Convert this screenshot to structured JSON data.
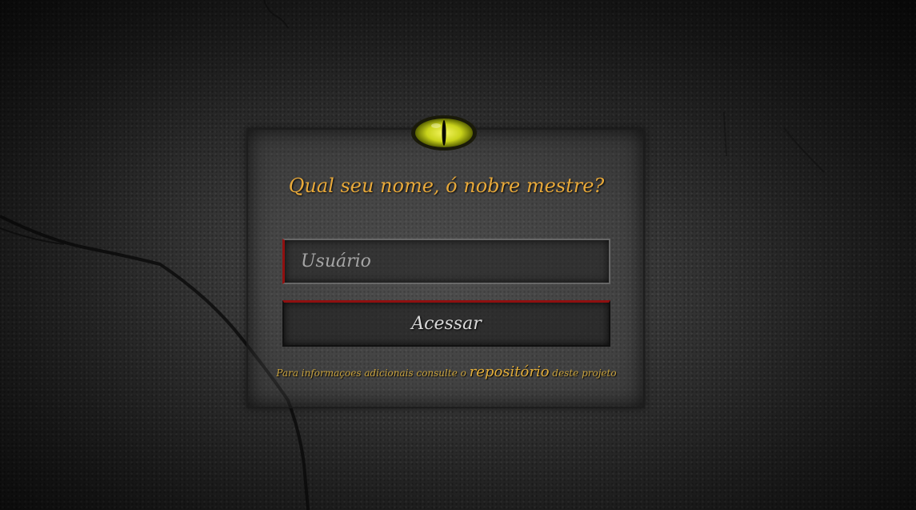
{
  "login": {
    "title": "Qual seu nome, ó nobre mestre?",
    "username_placeholder": "Usuário",
    "username_value": "",
    "submit_label": "Acessar",
    "info_prefix": "Para informaçoes adicionais consulte o",
    "repo_link": "repositório",
    "info_suffix": "deste projeto"
  },
  "colors": {
    "accent": "#e8a93a",
    "border_accent": "#8f1010",
    "eye": "#d9e020"
  },
  "icons": {
    "emblem": "dragon-eye-icon"
  }
}
